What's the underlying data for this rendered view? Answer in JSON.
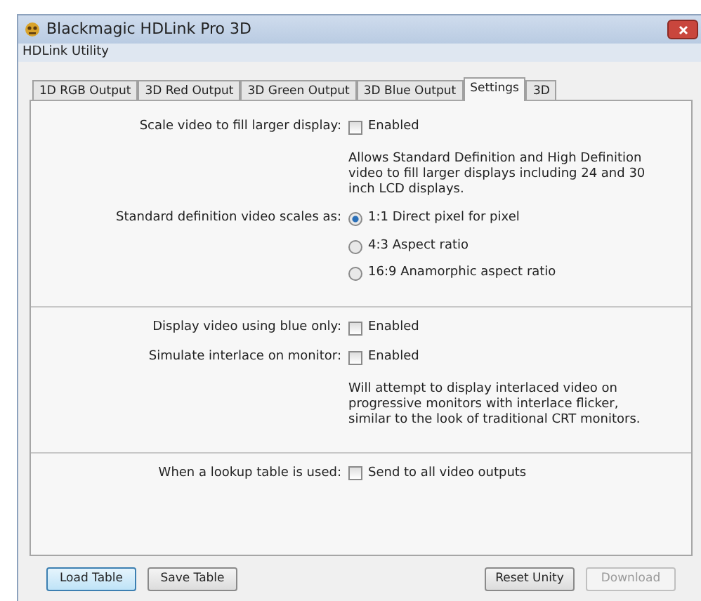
{
  "window": {
    "title": "Blackmagic HDLink Pro 3D",
    "subtitle": "HDLink Utility"
  },
  "tabs": [
    {
      "label": "1D RGB Output",
      "selected": false
    },
    {
      "label": "3D Red Output",
      "selected": false
    },
    {
      "label": "3D Green Output",
      "selected": false
    },
    {
      "label": "3D Blue Output",
      "selected": false
    },
    {
      "label": "Settings",
      "selected": true
    },
    {
      "label": "3D",
      "selected": false
    }
  ],
  "sections": [
    {
      "rows": [
        {
          "kind": "checkbox",
          "label": "Scale video to fill larger display:",
          "option": "Enabled",
          "checked": false,
          "description": "Allows Standard Definition and High Definition video to fill larger displays including 24 and 30 inch LCD displays."
        },
        {
          "kind": "radio",
          "label": "Standard definition video scales as:",
          "options": [
            {
              "label": "1:1 Direct pixel for pixel",
              "selected": true
            },
            {
              "label": "4:3 Aspect ratio",
              "selected": false
            },
            {
              "label": "16:9 Anamorphic aspect ratio",
              "selected": false
            }
          ]
        }
      ]
    },
    {
      "rows": [
        {
          "kind": "checkbox",
          "label": "Display video using blue only:",
          "option": "Enabled",
          "checked": false
        },
        {
          "kind": "checkbox",
          "label": "Simulate interlace on monitor:",
          "option": "Enabled",
          "checked": false,
          "description": "Will attempt to display interlaced video on progressive monitors with interlace flicker, similar to the look of traditional CRT monitors."
        }
      ]
    },
    {
      "rows": [
        {
          "kind": "checkbox",
          "label": "When a lookup table is used:",
          "option": "Send to all video outputs",
          "checked": false
        }
      ]
    }
  ],
  "buttons_left": [
    {
      "label": "Load Table",
      "focused": true,
      "disabled": false
    },
    {
      "label": "Save Table",
      "focused": false,
      "disabled": false
    }
  ],
  "buttons_right": [
    {
      "label": "Reset Unity",
      "focused": false,
      "disabled": false
    },
    {
      "label": "Download",
      "focused": false,
      "disabled": true
    }
  ]
}
